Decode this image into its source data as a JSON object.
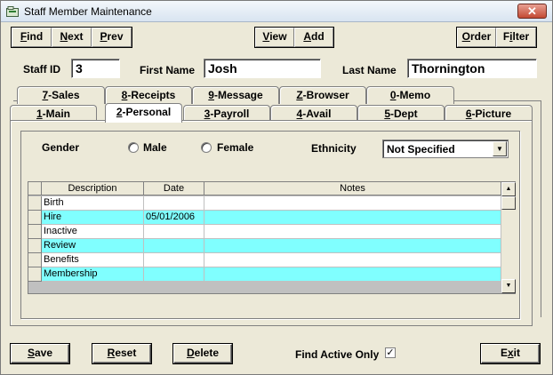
{
  "window": {
    "title": "Staff Member Maintenance",
    "close_glyph": "✕"
  },
  "toolbar": {
    "find": "Find",
    "find_ul": "F",
    "find_rest": "ind",
    "next": "Next",
    "next_ul": "N",
    "next_rest": "ext",
    "prev": "Prev",
    "prev_ul": "P",
    "prev_rest": "rev",
    "view": "View",
    "view_ul": "V",
    "view_rest": "iew",
    "add": "Add",
    "add_ul": "A",
    "add_rest": "dd",
    "order": "Order",
    "order_ul": "O",
    "order_rest": "rder",
    "filter": "Filter",
    "filter_ul": "i",
    "filter_pre": "F",
    "filter_rest": "lter"
  },
  "staff": {
    "id_label": "Staff ID",
    "id_value": "3",
    "first_label": "First Name",
    "first_value": "Josh",
    "last_label": "Last Name",
    "last_value": "Thornington"
  },
  "tabs_back": [
    {
      "num": "7",
      "label": "-Sales"
    },
    {
      "num": "8",
      "label": "-Receipts"
    },
    {
      "num": "9",
      "label": "-Message"
    },
    {
      "num": "Z",
      "label": "-Browser"
    },
    {
      "num": "0",
      "label": "-Memo"
    }
  ],
  "tabs_front": [
    {
      "num": "1",
      "label": "-Main"
    },
    {
      "num": "2",
      "label": "-Personal"
    },
    {
      "num": "3",
      "label": "-Payroll"
    },
    {
      "num": "4",
      "label": "-Avail"
    },
    {
      "num": "5",
      "label": "-Dept"
    },
    {
      "num": "6",
      "label": "-Picture"
    }
  ],
  "personal": {
    "gender_label": "Gender",
    "male_label": "Male",
    "female_label": "Female",
    "ethnicity_label": "Ethnicity",
    "ethnicity_value": "Not Specified"
  },
  "grid": {
    "columns": [
      "Description",
      "Date",
      "Notes"
    ],
    "rows": [
      {
        "description": "Birth",
        "date": "",
        "notes": ""
      },
      {
        "description": "Hire",
        "date": "05/01/2006",
        "notes": ""
      },
      {
        "description": "Inactive",
        "date": "",
        "notes": ""
      },
      {
        "description": "Review",
        "date": "",
        "notes": ""
      },
      {
        "description": "Benefits",
        "date": "",
        "notes": ""
      },
      {
        "description": "Membership",
        "date": "",
        "notes": ""
      }
    ],
    "alt_row_color": "#80ffff"
  },
  "footer": {
    "save_ul": "S",
    "save_rest": "ave",
    "reset_ul": "R",
    "reset_rest": "eset",
    "delete_ul": "D",
    "delete_rest": "elete",
    "find_active_label": "Find Active Only",
    "find_active_checked": "✓",
    "exit_pre": "E",
    "exit_ul": "x",
    "exit_rest": "it"
  }
}
